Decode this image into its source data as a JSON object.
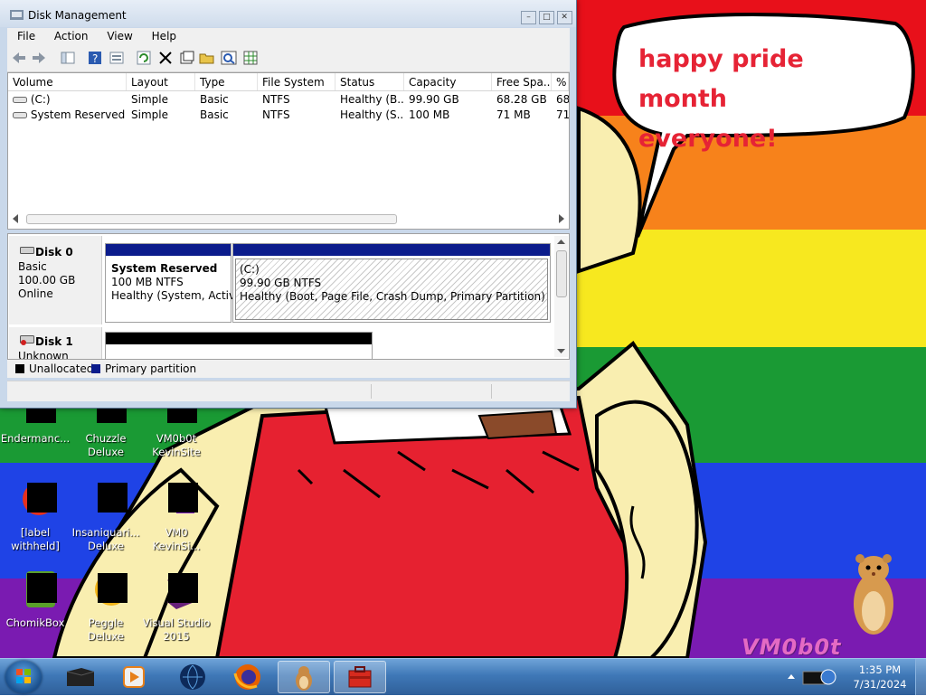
{
  "window": {
    "title": "Disk Management",
    "controls": {
      "minimize": "–",
      "maximize": "□",
      "close": "✕"
    }
  },
  "menu": {
    "items": [
      "File",
      "Action",
      "View",
      "Help"
    ]
  },
  "toolbar": {
    "icons": [
      "back-arrow-icon",
      "forward-arrow-icon",
      "show-hide-tree-icon",
      "help-icon",
      "properties-icon",
      "refresh-icon",
      "delete-icon",
      "settings-icon",
      "open-folder-icon",
      "search-icon",
      "view-grid-icon"
    ]
  },
  "volumes": {
    "columns": [
      "Volume",
      "Layout",
      "Type",
      "File System",
      "Status",
      "Capacity",
      "Free Spa...",
      "%"
    ],
    "rows": [
      {
        "volume": "(C:)",
        "layout": "Simple",
        "type": "Basic",
        "fs": "NTFS",
        "status": "Healthy (B...",
        "capacity": "99.90 GB",
        "free": "68.28 GB",
        "pct": "68"
      },
      {
        "volume": "System Reserved",
        "layout": "Simple",
        "type": "Basic",
        "fs": "NTFS",
        "status": "Healthy (S...",
        "capacity": "100 MB",
        "free": "71 MB",
        "pct": "71"
      }
    ]
  },
  "disks": [
    {
      "name": "Disk 0",
      "type": "Basic",
      "size": "100.00 GB",
      "state": "Online",
      "partitions": [
        {
          "name": "System Reserved",
          "size": "100 MB NTFS",
          "status": "Healthy (System, Active"
        },
        {
          "name": "(C:)",
          "size": "99.90 GB NTFS",
          "status": "Healthy (Boot, Page File, Crash Dump, Primary Partition)"
        }
      ]
    },
    {
      "name": "Disk 1",
      "type": "Unknown"
    }
  ],
  "legend": {
    "items": [
      {
        "label": "Unallocated",
        "color": "#000000"
      },
      {
        "label": "Primary partition",
        "color": "#0b1c8c"
      }
    ]
  },
  "wallpaper": {
    "speech": [
      "happy pride month",
      "everyone!"
    ],
    "logo": "VM0b0t",
    "stripes": [
      "#e8101a",
      "#f7821b",
      "#f7e81f",
      "#1a9a34",
      "#1f43e6",
      "#7a1bb1"
    ]
  },
  "desktop_icons": [
    {
      "label": "Endermanc..."
    },
    {
      "label": "Chuzzle Deluxe"
    },
    {
      "label": "VM0b0t KevinSite"
    },
    {
      "label": "[label withheld]"
    },
    {
      "label": "Insaniquari... Deluxe"
    },
    {
      "label": "VM0 KevinSi..."
    },
    {
      "label": "ChomikBox"
    },
    {
      "label": "Peggle Deluxe"
    },
    {
      "label": "Visual Studio 2015"
    }
  ],
  "taskbar": {
    "time": "1:35 PM",
    "date": "7/31/2024",
    "buttons": [
      "explorer-icon",
      "media-player-icon",
      "app-globe-icon",
      "firefox-icon",
      "hamster-app-icon",
      "toolbox-icon"
    ]
  }
}
